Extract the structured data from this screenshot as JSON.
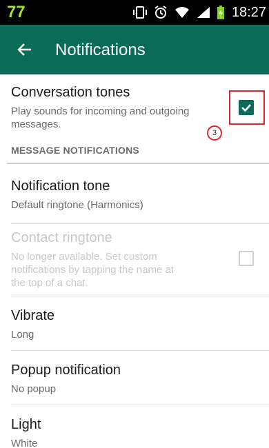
{
  "status_bar": {
    "left_badge": "77",
    "time": "18:27",
    "icons": [
      "vibrate-icon",
      "alarm-icon",
      "wifi-icon",
      "signal-icon",
      "battery-charging-icon"
    ]
  },
  "app_bar": {
    "back_icon": "arrow-back-icon",
    "title": "Notifications"
  },
  "settings": {
    "conversation_tones": {
      "title": "Conversation tones",
      "subtitle_line1": "Play sounds for incoming and outgoing",
      "subtitle_line2": "messages.",
      "checked": true
    },
    "category_label": "MESSAGE NOTIFICATIONS",
    "notification_tone": {
      "title": "Notification tone",
      "subtitle": "Default ringtone (Harmonics)"
    },
    "contact_ringtone": {
      "title": "Contact ringtone",
      "subtitle_line1": "No longer available. Set custom",
      "subtitle_line2": "notifications by tapping the name at",
      "subtitle_line3": "the top of a chat.",
      "checked": false,
      "enabled": false
    },
    "vibrate": {
      "title": "Vibrate",
      "subtitle": "Long"
    },
    "popup_notification": {
      "title": "Popup notification",
      "subtitle": "No popup"
    },
    "light": {
      "title": "Light",
      "subtitle": "White"
    }
  },
  "annotation": {
    "label": "3",
    "color": "#e0262c"
  },
  "colors": {
    "accent": "#0b6b59",
    "status_badge": "#a6e22e"
  }
}
